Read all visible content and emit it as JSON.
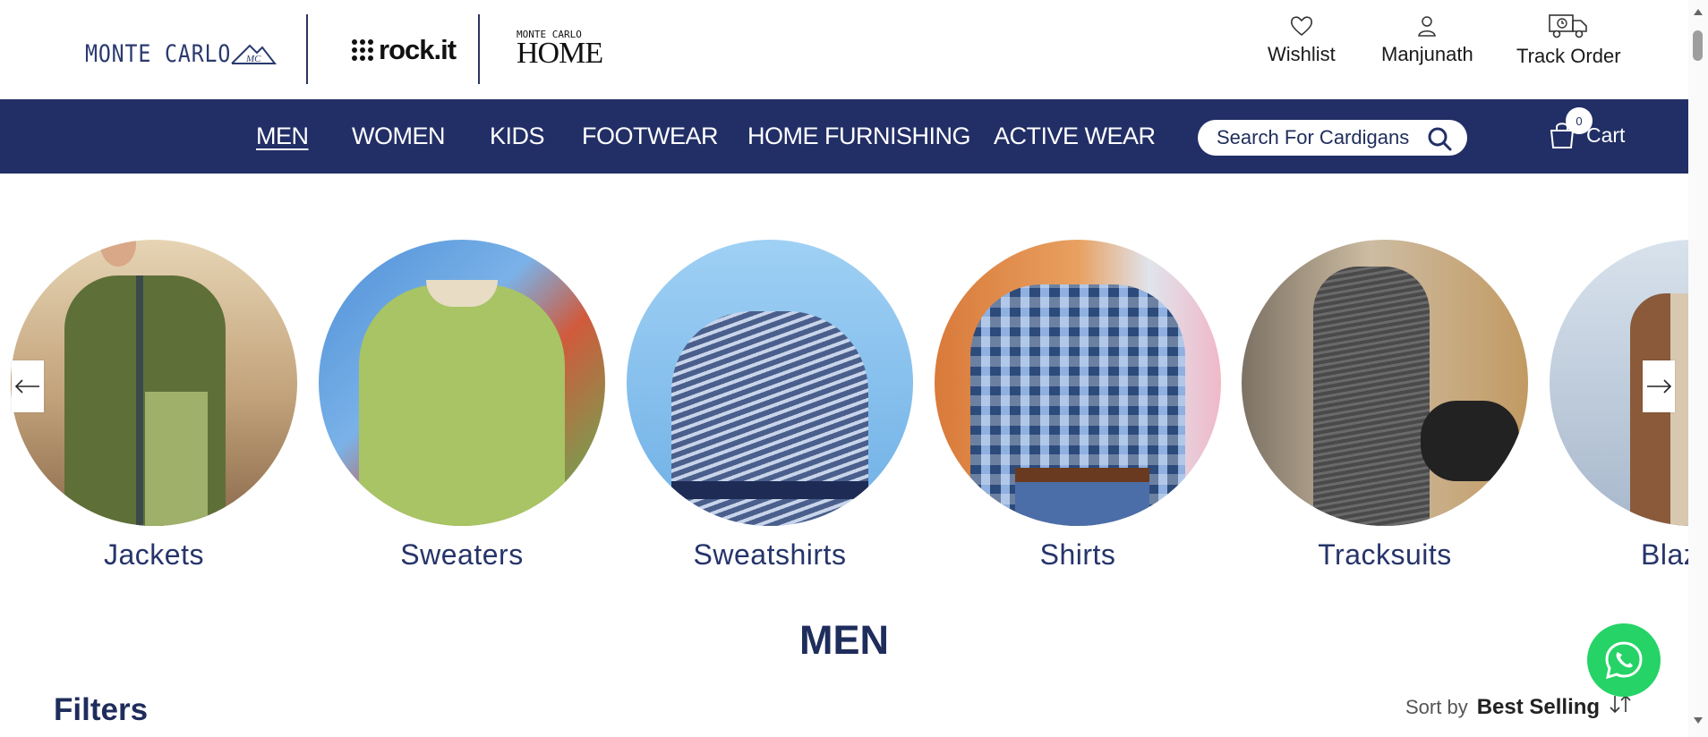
{
  "header": {
    "logos": {
      "monte_carlo": "MONTE CARLO",
      "monte_carlo_mark": "MC",
      "rockit": "rock.it",
      "home_small": "MONTE CARLO",
      "home_big": "HOME"
    },
    "actions": [
      {
        "label": "Wishlist",
        "icon": "heart-icon"
      },
      {
        "label": "Manjunath",
        "icon": "user-icon"
      },
      {
        "label": "Track Order",
        "icon": "truck-icon"
      }
    ]
  },
  "nav": {
    "items": [
      {
        "label": "MEN",
        "active": true
      },
      {
        "label": "WOMEN",
        "active": false
      },
      {
        "label": "KIDS",
        "active": false
      },
      {
        "label": "FOOTWEAR",
        "active": false
      },
      {
        "label": "HOME FURNISHING",
        "active": false
      },
      {
        "label": "ACTIVE WEAR",
        "active": false
      }
    ],
    "search_placeholder": "Search For Cardigans",
    "cart_label": "Cart",
    "cart_count": "0"
  },
  "categories": [
    {
      "name": "Jackets",
      "bg": "#c9b08a",
      "garment": "#5e7038",
      "accent": "#9fb06a"
    },
    {
      "name": "Sweaters",
      "bg": "#5b9be0",
      "garment": "#a8c464",
      "accent": "#e8b0b0"
    },
    {
      "name": "Sweatshirts",
      "bg": "#8ec6f0",
      "garment": "#4a5f8c",
      "accent": "#1e2b55"
    },
    {
      "name": "Shirts",
      "bg": "#d97a3a",
      "garment": "#5a82c0",
      "accent": "#2c4a7a"
    },
    {
      "name": "Tracksuits",
      "bg": "#b89a78",
      "garment": "#4a4a4a",
      "accent": "#2a2a2a"
    },
    {
      "name": "Blazers",
      "bg": "#c8d4e0",
      "garment": "#8a5a3a",
      "accent": "#d8c8b0"
    }
  ],
  "section_title": "MEN",
  "filters_label": "Filters",
  "sort": {
    "label": "Sort by",
    "value": "Best Selling"
  },
  "colors": {
    "brand_navy": "#222f66",
    "whatsapp_green": "#25d366"
  }
}
